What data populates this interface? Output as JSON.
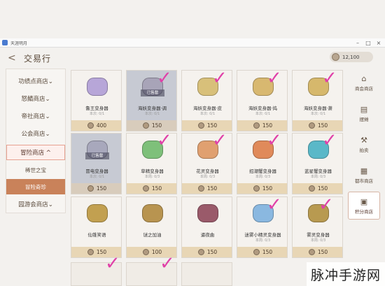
{
  "window": {
    "title": "天涯明月"
  },
  "header": {
    "back_icon": "back-arrow-icon",
    "title": "交易行",
    "currency_icon": "coin-icon",
    "currency": "12,100"
  },
  "leftnav": {
    "items": [
      {
        "label": "功绩点商店⌄"
      },
      {
        "label": "怒鲭商店⌄"
      },
      {
        "label": "帝社商店⌄"
      },
      {
        "label": "公会商店⌄"
      },
      {
        "label": "冒险商店 ^"
      },
      {
        "label": "园游会商店⌄"
      }
    ],
    "subitems": [
      {
        "label": "稀世之宝"
      },
      {
        "label": "冒险奇珍"
      }
    ]
  },
  "rightnav": [
    {
      "icon": "shop-icon",
      "label": "商会商店"
    },
    {
      "icon": "stall-icon",
      "label": "摆摊"
    },
    {
      "icon": "auction-icon",
      "label": "拍卖"
    },
    {
      "icon": "city-icon",
      "label": "都市商店"
    },
    {
      "icon": "points-icon",
      "label": "积分商店"
    }
  ],
  "sold_label": "已售罄",
  "cards": [
    {
      "name": "鲁王变身器",
      "limit": "本次: 0/1",
      "price": "400",
      "color": "#b7a6d8"
    },
    {
      "name": "海妖变身器·调",
      "limit": "本次: 0/1",
      "price": "150",
      "color": "#a8a4b8",
      "sold": true
    },
    {
      "name": "海妖变身器·皮",
      "limit": "本次: 0/1",
      "price": "150",
      "color": "#d8c07a"
    },
    {
      "name": "海妖变身器·捣",
      "limit": "本次: 0/1",
      "price": "150",
      "color": "#d8b870"
    },
    {
      "name": "海妖变身器·萧",
      "limit": "本次: 0/1",
      "price": "150",
      "color": "#d6b86c"
    },
    {
      "name": "冒电变身器",
      "limit": "本次: 0/1",
      "price": "150",
      "color": "#a8a8bc",
      "sold": true
    },
    {
      "name": "草精变身器",
      "limit": "本周: 0/3",
      "price": "150",
      "color": "#7ec07a"
    },
    {
      "name": "花灵变身器",
      "limit": "本周: 0/3",
      "price": "150",
      "color": "#e0a070"
    },
    {
      "name": "招潮蟹变身器",
      "limit": "本周: 0/3",
      "price": "150",
      "color": "#e08a5a"
    },
    {
      "name": "蓝星蟹变身器",
      "limit": "本周: 0/3",
      "price": "150",
      "color": "#5ab8c8"
    },
    {
      "name": "仙锥笑语",
      "limit": "",
      "price": "150",
      "color": "#c2a050"
    },
    {
      "name": "谜之加油",
      "limit": "",
      "price": "100",
      "color": "#b89450"
    },
    {
      "name": "逼夜曲",
      "limit": "",
      "price": "150",
      "color": "#9a5a6a"
    },
    {
      "name": "迷雾小精灵变身器",
      "limit": "本周: 0/3",
      "price": "150",
      "color": "#8ab8e0"
    },
    {
      "name": "雾灵变身器",
      "limit": "本周: 0/3",
      "price": "150",
      "color": "#b89a50"
    }
  ],
  "watermark": "脉冲手游网"
}
